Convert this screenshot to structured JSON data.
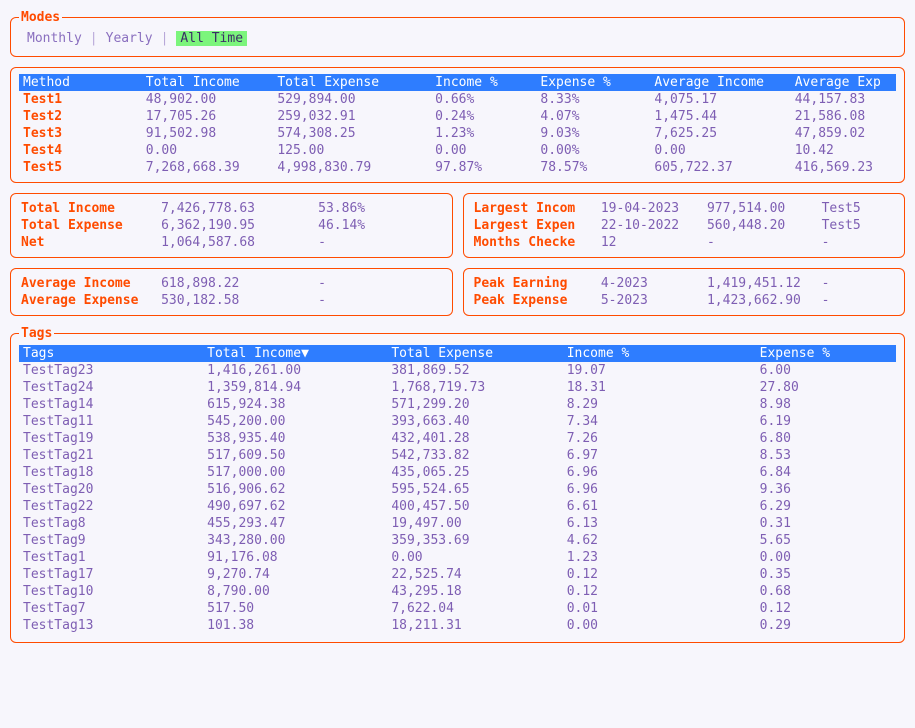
{
  "modes": {
    "legend": "Modes",
    "items": [
      {
        "label": "Monthly",
        "selected": false
      },
      {
        "label": "Yearly",
        "selected": false
      },
      {
        "label": "All Time",
        "selected": true
      }
    ]
  },
  "methods_table": {
    "headers": [
      "Method",
      "Total Income",
      "Total Expense",
      "Income %",
      "Expense %",
      "Average Income",
      "Average Exp"
    ],
    "rows": [
      {
        "method": "Test1",
        "ti": "48,902.00",
        "te": "529,894.00",
        "ip": "0.66%",
        "ep": "8.33%",
        "ai": "4,075.17",
        "ae": "44,157.83"
      },
      {
        "method": "Test2",
        "ti": "17,705.26",
        "te": "259,032.91",
        "ip": "0.24%",
        "ep": "4.07%",
        "ai": "1,475.44",
        "ae": "21,586.08"
      },
      {
        "method": "Test3",
        "ti": "91,502.98",
        "te": "574,308.25",
        "ip": "1.23%",
        "ep": "9.03%",
        "ai": "7,625.25",
        "ae": "47,859.02"
      },
      {
        "method": "Test4",
        "ti": "0.00",
        "te": "125.00",
        "ip": "0.00",
        "ep": "0.00%",
        "ai": "0.00",
        "ae": "10.42"
      },
      {
        "method": "Test5",
        "ti": "7,268,668.39",
        "te": "4,998,830.79",
        "ip": "97.87%",
        "ep": "78.57%",
        "ai": "605,722.37",
        "ae": "416,569.23"
      }
    ]
  },
  "totals_left": [
    {
      "label": "Total Income",
      "v1": "7,426,778.63",
      "v2": "53.86%"
    },
    {
      "label": "Total Expense",
      "v1": "6,362,190.95",
      "v2": "46.14%"
    },
    {
      "label": "Net",
      "v1": "1,064,587.68",
      "v2": "-"
    }
  ],
  "totals_right": [
    {
      "label": "Largest Incom",
      "v1": "19-04-2023",
      "v2": "977,514.00",
      "v3": "Test5"
    },
    {
      "label": "Largest Expen",
      "v1": "22-10-2022",
      "v2": "560,448.20",
      "v3": "Test5"
    },
    {
      "label": "Months Checke",
      "v1": "12",
      "v2": "-",
      "v3": "-"
    }
  ],
  "avg_left": [
    {
      "label": "Average Income",
      "v1": "618,898.22",
      "v2": "-"
    },
    {
      "label": "Average Expense",
      "v1": "530,182.58",
      "v2": "-"
    }
  ],
  "avg_right": [
    {
      "label": "Peak Earning",
      "v1": "4-2023",
      "v2": "1,419,451.12",
      "v3": "-"
    },
    {
      "label": "Peak Expense",
      "v1": "5-2023",
      "v2": "1,423,662.90",
      "v3": "-"
    }
  ],
  "tags": {
    "legend": "Tags",
    "headers": [
      "Tags",
      "Total Income▼",
      "Total Expense",
      "Income %",
      "Expense %"
    ],
    "rows": [
      {
        "t": "TestTag23",
        "ti": "1,416,261.00",
        "te": "381,869.52",
        "ip": "19.07",
        "ep": "6.00"
      },
      {
        "t": "TestTag24",
        "ti": "1,359,814.94",
        "te": "1,768,719.73",
        "ip": "18.31",
        "ep": "27.80"
      },
      {
        "t": "TestTag14",
        "ti": "615,924.38",
        "te": "571,299.20",
        "ip": "8.29",
        "ep": "8.98"
      },
      {
        "t": "TestTag11",
        "ti": "545,200.00",
        "te": "393,663.40",
        "ip": "7.34",
        "ep": "6.19"
      },
      {
        "t": "TestTag19",
        "ti": "538,935.40",
        "te": "432,401.28",
        "ip": "7.26",
        "ep": "6.80"
      },
      {
        "t": "TestTag21",
        "ti": "517,609.50",
        "te": "542,733.82",
        "ip": "6.97",
        "ep": "8.53"
      },
      {
        "t": "TestTag18",
        "ti": "517,000.00",
        "te": "435,065.25",
        "ip": "6.96",
        "ep": "6.84"
      },
      {
        "t": "TestTag20",
        "ti": "516,906.62",
        "te": "595,524.65",
        "ip": "6.96",
        "ep": "9.36"
      },
      {
        "t": "TestTag22",
        "ti": "490,697.62",
        "te": "400,457.50",
        "ip": "6.61",
        "ep": "6.29"
      },
      {
        "t": "TestTag8",
        "ti": "455,293.47",
        "te": "19,497.00",
        "ip": "6.13",
        "ep": "0.31"
      },
      {
        "t": "TestTag9",
        "ti": "343,280.00",
        "te": "359,353.69",
        "ip": "4.62",
        "ep": "5.65"
      },
      {
        "t": "TestTag1",
        "ti": "91,176.08",
        "te": "0.00",
        "ip": "1.23",
        "ep": "0.00"
      },
      {
        "t": "TestTag17",
        "ti": "9,270.74",
        "te": "22,525.74",
        "ip": "0.12",
        "ep": "0.35"
      },
      {
        "t": "TestTag10",
        "ti": "8,790.00",
        "te": "43,295.18",
        "ip": "0.12",
        "ep": "0.68"
      },
      {
        "t": "TestTag7",
        "ti": "517.50",
        "te": "7,622.04",
        "ip": "0.01",
        "ep": "0.12"
      },
      {
        "t": "TestTag13",
        "ti": "101.38",
        "te": "18,211.31",
        "ip": "0.00",
        "ep": "0.29"
      }
    ]
  }
}
